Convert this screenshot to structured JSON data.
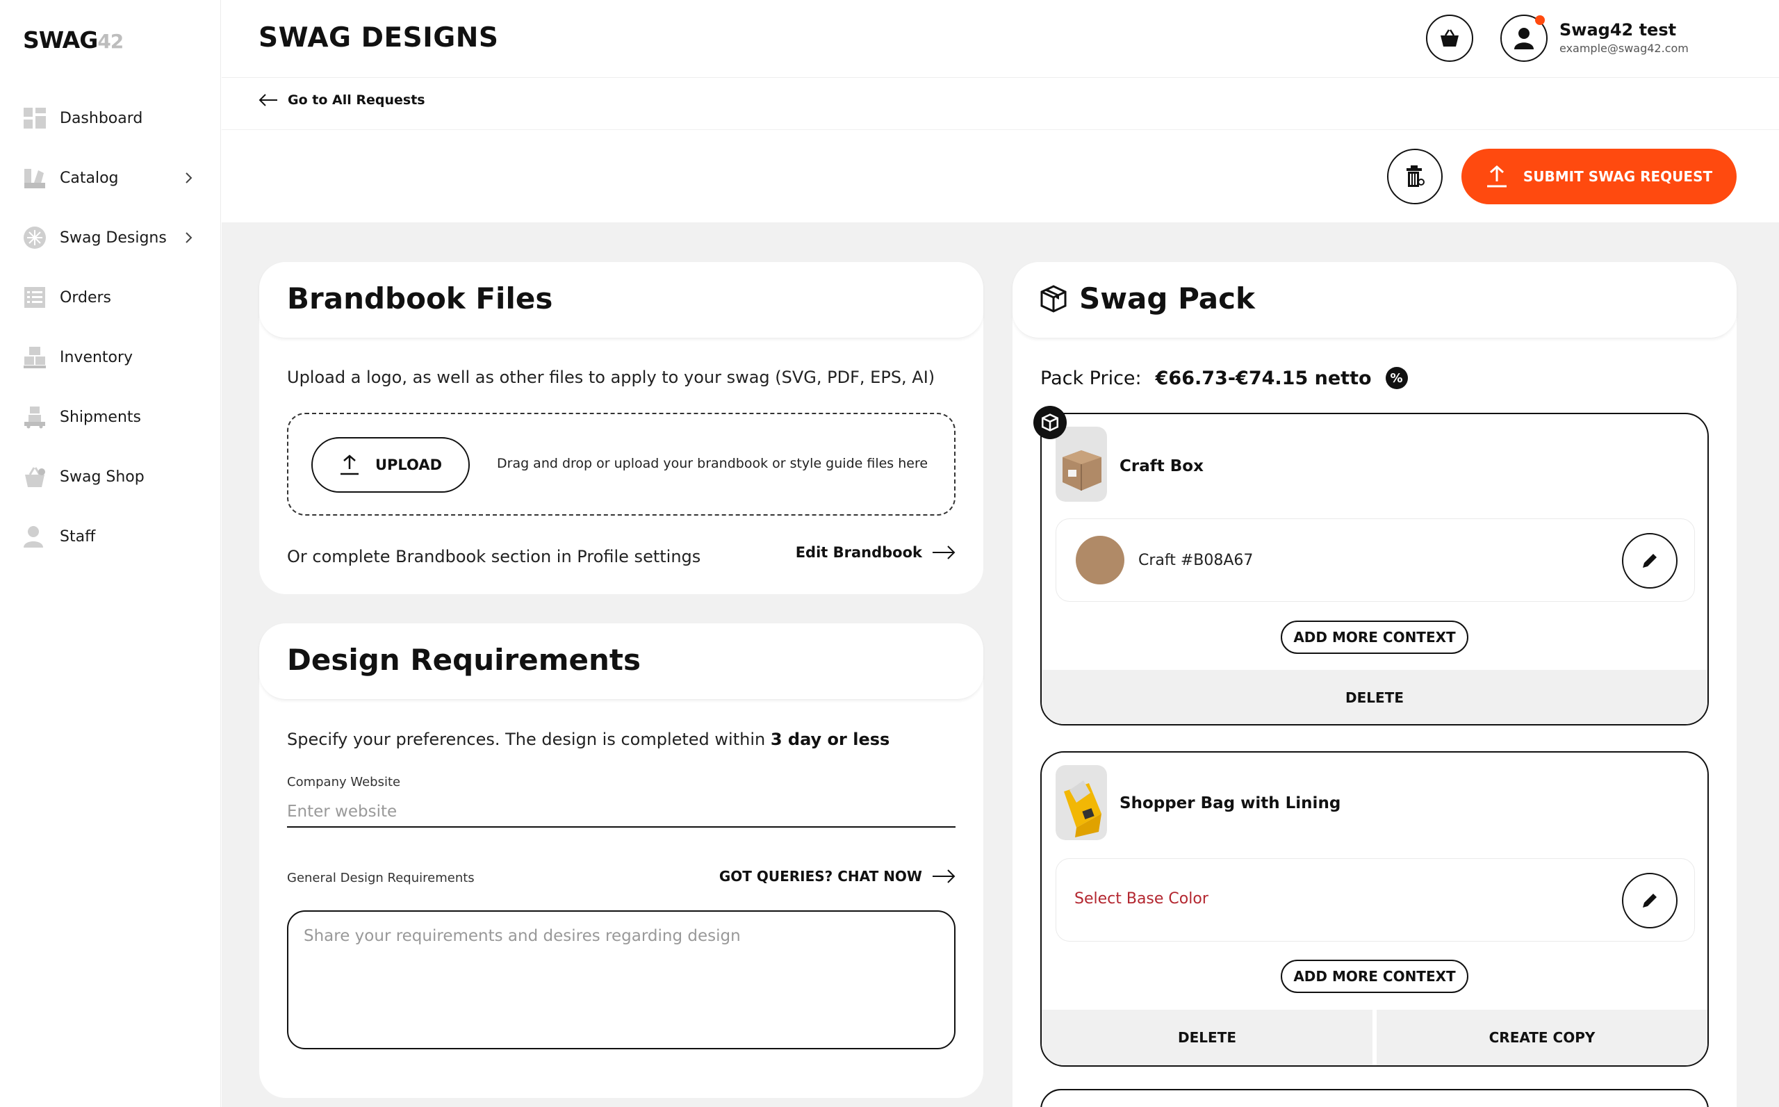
{
  "brand": {
    "logo_main": "SWAG",
    "logo_num": "42"
  },
  "sidebar": {
    "items": [
      {
        "label": "Dashboard",
        "icon": "dashboard-icon",
        "has_chevron": false
      },
      {
        "label": "Catalog",
        "icon": "catalog-icon",
        "has_chevron": true
      },
      {
        "label": "Swag Designs",
        "icon": "swag-designs-icon",
        "has_chevron": true
      },
      {
        "label": "Orders",
        "icon": "orders-icon",
        "has_chevron": false
      },
      {
        "label": "Inventory",
        "icon": "inventory-icon",
        "has_chevron": false
      },
      {
        "label": "Shipments",
        "icon": "shipments-icon",
        "has_chevron": false
      },
      {
        "label": "Swag Shop",
        "icon": "swag-shop-icon",
        "has_chevron": false
      },
      {
        "label": "Staff",
        "icon": "staff-icon",
        "has_chevron": false
      }
    ]
  },
  "header": {
    "title": "SWAG DESIGNS",
    "user_name": "Swag42 test",
    "user_email": "example@swag42.com"
  },
  "subbar": {
    "back_label": "Go to All Requests"
  },
  "actions": {
    "submit_label": "SUBMIT SWAG REQUEST"
  },
  "brandbook": {
    "title": "Brandbook Files",
    "description": "Upload a logo, as well as other files to apply to your swag (SVG, PDF, EPS, AI)",
    "upload_label": "UPLOAD",
    "dropzone_text": "Drag and drop or upload your brandbook or style guide files here",
    "alt_text": "Or complete Brandbook section in Profile settings",
    "edit_label": "Edit Brandbook"
  },
  "design_requirements": {
    "title": "Design Requirements",
    "description_prefix": "Specify your preferences. The design is completed within ",
    "description_bold": "3 day or less",
    "website_label": "Company Website",
    "website_placeholder": "Enter website",
    "website_value": "",
    "general_label": "General Design Requirements",
    "chat_label": "GOT QUERIES? CHAT NOW",
    "requirements_placeholder": "Share your requirements and desires regarding design"
  },
  "swag_pack": {
    "title": "Swag Pack",
    "price_label": "Pack Price:",
    "price_value": "€66.73-€74.15 netto",
    "discount_symbol": "%",
    "items": [
      {
        "name": "Craft Box",
        "color_label": "Craft #B08A67",
        "color_hex": "#B08A67",
        "context_label": "ADD MORE CONTEXT",
        "actions": [
          "DELETE"
        ]
      },
      {
        "name": "Shopper Bag with Lining",
        "color_label": "Select Base Color",
        "context_label": "ADD MORE CONTEXT",
        "actions": [
          "DELETE",
          "CREATE COPY"
        ]
      }
    ]
  },
  "colors": {
    "accent": "#ff4a0f",
    "text": "#111111",
    "content_bg": "#f1f1f1",
    "error_text": "#b3262f"
  }
}
